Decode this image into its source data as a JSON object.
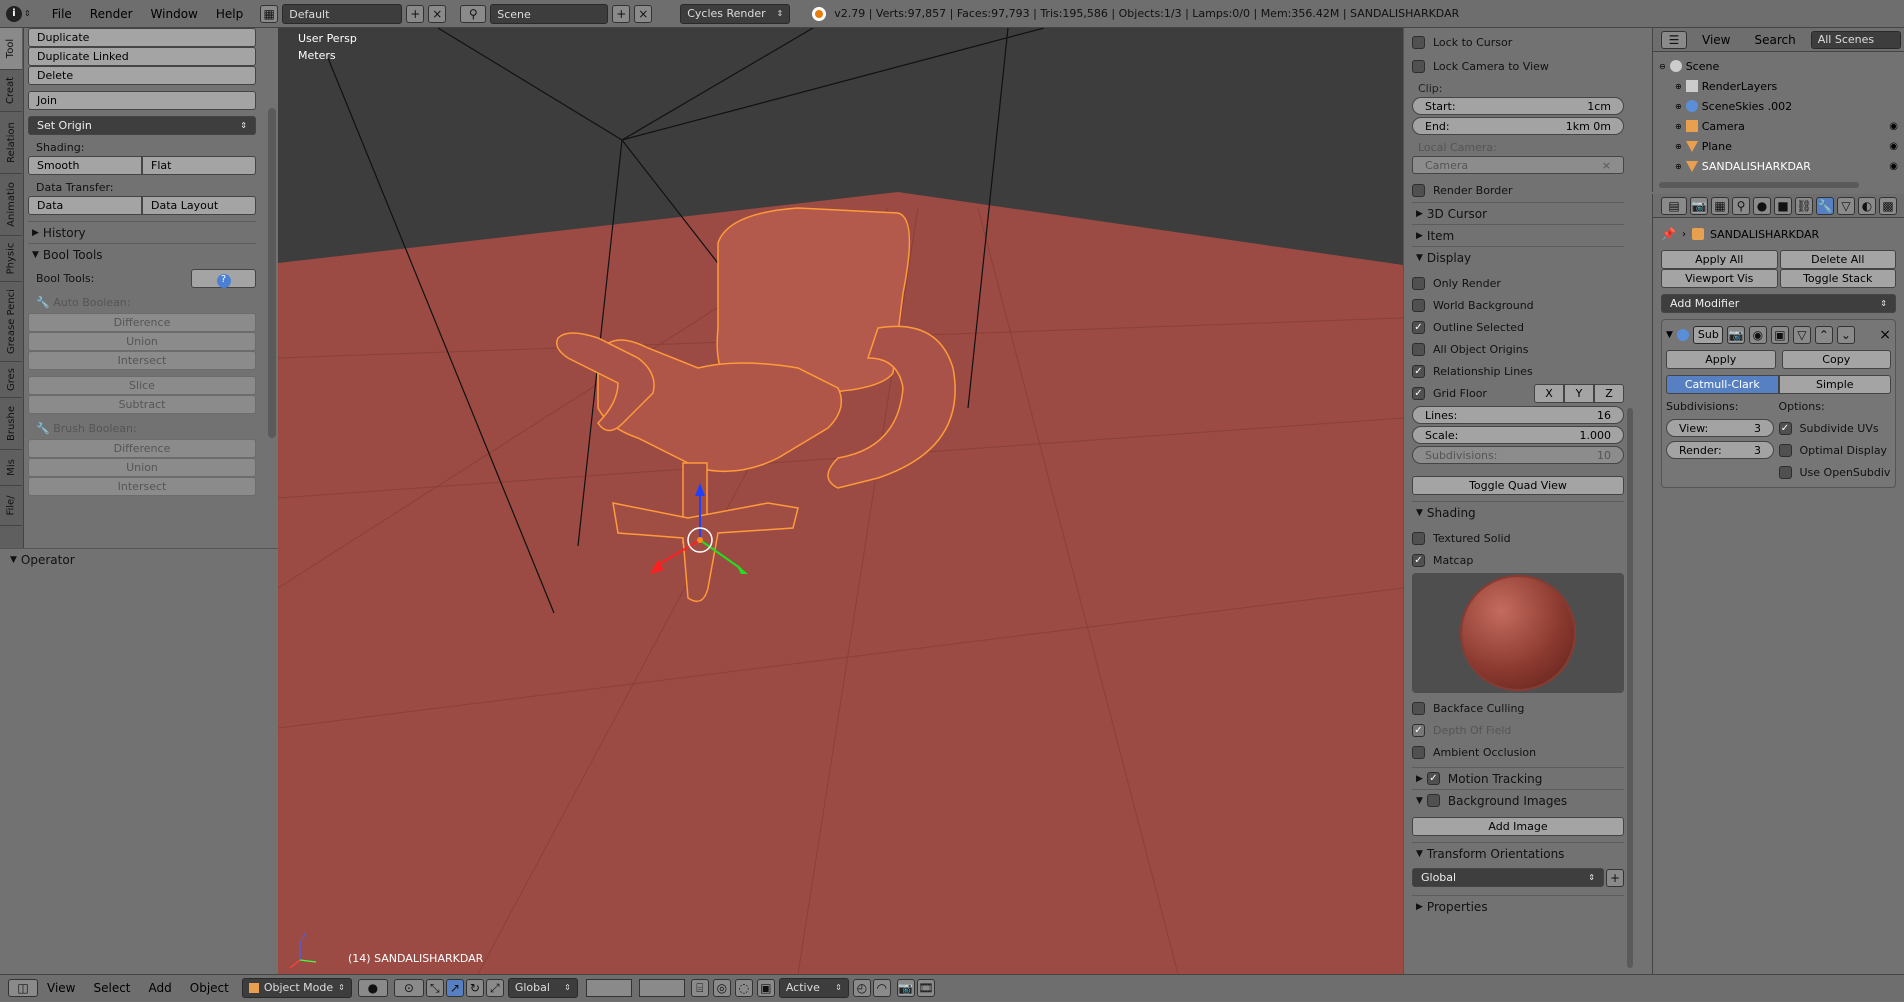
{
  "top_bar": {
    "menus": [
      "File",
      "Render",
      "Window",
      "Help"
    ],
    "layout": "Default",
    "scene": "Scene",
    "render_engine": "Cycles Render",
    "stats": "v2.79 | Verts:97,857 | Faces:97,793 | Tris:195,586 | Objects:1/3 | Lamps:0/0 | Mem:356.42M | SANDALISHARKDAR"
  },
  "tool_tabs": [
    "Tool",
    "Creat",
    "Relation",
    "Animatio",
    "Physic",
    "Grease Penci",
    "Gres",
    "Brushe",
    "Mis",
    "File/"
  ],
  "tool_shelf": {
    "buttons": [
      "Duplicate",
      "Duplicate Linked",
      "Delete"
    ],
    "join": "Join",
    "set_origin": "Set Origin",
    "shading_label": "Shading:",
    "smooth": "Smooth",
    "flat": "Flat",
    "data_transfer_label": "Data Transfer:",
    "data": "Data",
    "data_layout": "Data Layout",
    "history": "History",
    "bool_tools": "Bool Tools",
    "bool_tools_label": "Bool Tools:",
    "auto_boolean": "Auto Boolean:",
    "auto_ops": [
      "Difference",
      "Union",
      "Intersect"
    ],
    "slice": "Slice",
    "subtract": "Subtract",
    "brush_boolean": "Brush Boolean:",
    "brush_ops": [
      "Difference",
      "Union",
      "Intersect"
    ],
    "operator": "Operator"
  },
  "viewport": {
    "view_name": "User Persp",
    "units": "Meters",
    "object_label": "(14) SANDALISHARKDAR"
  },
  "n_panel": {
    "lock_to_cursor": "Lock to Cursor",
    "lock_camera": "Lock Camera to View",
    "clip": "Clip:",
    "start_label": "Start:",
    "start_value": "1cm",
    "end_label": "End:",
    "end_value": "1km 0m",
    "local_camera": "Local Camera:",
    "camera": "Camera",
    "render_border": "Render Border",
    "cursor_3d": "3D Cursor",
    "item": "Item",
    "display": "Display",
    "display_opts": [
      {
        "label": "Only Render",
        "checked": false
      },
      {
        "label": "World Background",
        "checked": false
      },
      {
        "label": "Outline Selected",
        "checked": true
      },
      {
        "label": "All Object Origins",
        "checked": false
      },
      {
        "label": "Relationship Lines",
        "checked": true
      }
    ],
    "grid_floor": "Grid Floor",
    "axes": [
      "X",
      "Y",
      "Z"
    ],
    "lines_label": "Lines:",
    "lines_value": "16",
    "scale_label": "Scale:",
    "scale_value": "1.000",
    "subdiv_label": "Subdivisions:",
    "subdiv_value": "10",
    "toggle_quad": "Toggle Quad View",
    "shading": "Shading",
    "textured_solid": "Textured Solid",
    "matcap": "Matcap",
    "backface": "Backface Culling",
    "dof": "Depth Of Field",
    "ao": "Ambient Occlusion",
    "motion_tracking": "Motion Tracking",
    "bg_images": "Background Images",
    "add_image": "Add Image",
    "transform_orient": "Transform Orientations",
    "global": "Global",
    "properties": "Properties"
  },
  "outliner": {
    "view": "View",
    "search": "Search",
    "all_scenes": "All Scenes",
    "items": [
      {
        "label": "Scene",
        "indent": 0,
        "color": "#000"
      },
      {
        "label": "RenderLayers",
        "indent": 1,
        "color": "#000"
      },
      {
        "label": "SceneSkies .002",
        "indent": 1,
        "color": "#000"
      },
      {
        "label": "Camera",
        "indent": 1,
        "color": "#000"
      },
      {
        "label": "Plane",
        "indent": 1,
        "color": "#000"
      },
      {
        "label": "SANDALISHARKDAR",
        "indent": 1,
        "color": "#fff"
      }
    ]
  },
  "properties": {
    "object_name": "SANDALISHARKDAR",
    "apply_all": "Apply All",
    "delete_all": "Delete All",
    "viewport_vis": "Viewport Vis",
    "toggle_stack": "Toggle Stack",
    "add_modifier": "Add Modifier",
    "modifier_name": "Sub",
    "apply": "Apply",
    "copy": "Copy",
    "catmull": "Catmull-Clark",
    "simple": "Simple",
    "subdivisions": "Subdivisions:",
    "options": "Options:",
    "view_label": "View:",
    "view_value": "3",
    "render_label": "Render:",
    "render_value": "3",
    "subdivide_uvs": "Subdivide UVs",
    "optimal_display": "Optimal Display",
    "use_opensubdiv": "Use OpenSubdiv"
  },
  "bottom_bar": {
    "menus": [
      "View",
      "Select",
      "Add",
      "Object"
    ],
    "mode": "Object Mode",
    "orientation": "Global",
    "pivot": "Active"
  }
}
